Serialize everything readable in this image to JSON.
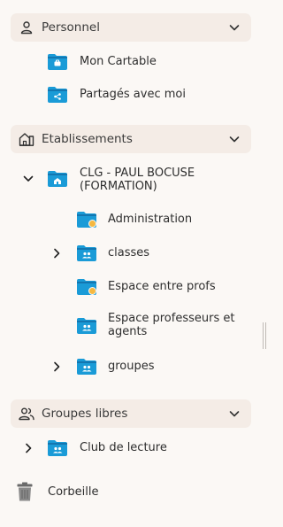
{
  "sections": {
    "personnel": {
      "title": "Personnel",
      "icon": "user-icon",
      "items": [
        {
          "label": "Mon Cartable",
          "icon": "folder-briefcase-icon"
        },
        {
          "label": "Partagés avec moi",
          "icon": "folder-share-icon"
        }
      ]
    },
    "etablissements": {
      "title": "Etablissements",
      "icon": "school-icon",
      "school": {
        "label": "CLG - PAUL BOCUSE (FORMATION)",
        "icon": "folder-school-icon",
        "children": [
          {
            "label": "Administration",
            "icon": "folder-badge-icon"
          },
          {
            "label": "classes",
            "icon": "folder-group-icon"
          },
          {
            "label": "Espace entre profs",
            "icon": "folder-badge-icon"
          },
          {
            "label": "Espace professeurs et agents",
            "icon": "folder-group-icon"
          },
          {
            "label": "groupes",
            "icon": "folder-group-icon"
          }
        ]
      }
    },
    "groupes_libres": {
      "title": "Groupes libres",
      "icon": "users-icon",
      "items": [
        {
          "label": "Club de lecture",
          "icon": "folder-group-icon"
        }
      ]
    },
    "trash": {
      "label": "Corbeille",
      "icon": "trash-icon"
    }
  },
  "colors": {
    "folder": "#1a9bd7",
    "folder_tab": "#1376b0",
    "badge": "#f5b840",
    "header_bg": "#f4ece6",
    "page_bg": "#fbf8f5"
  }
}
